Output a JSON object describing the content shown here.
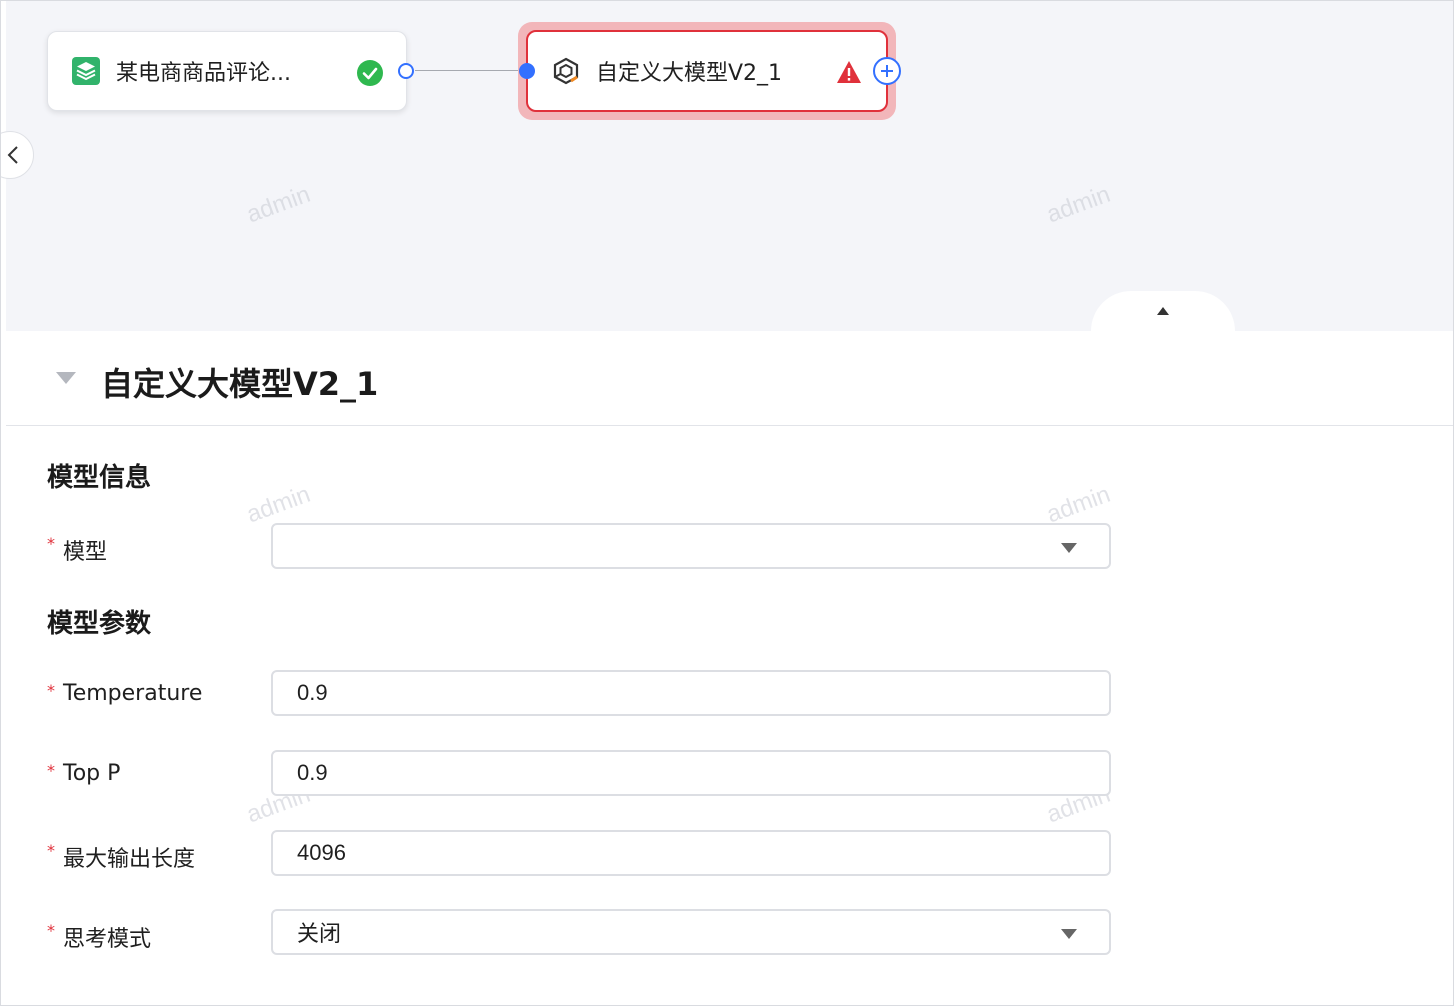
{
  "canvas": {
    "watermark_text": "admin",
    "source_node": {
      "title": "某电商商品评论...",
      "status": "success"
    },
    "model_node": {
      "title": "自定义大模型V2_1",
      "status": "error"
    }
  },
  "panel": {
    "title": "自定义大模型V2_1",
    "sections": {
      "model_info": "模型信息",
      "model_params": "模型参数"
    },
    "fields": {
      "model": {
        "label": "模型",
        "value": ""
      },
      "temperature": {
        "label": "Temperature",
        "value": "0.9"
      },
      "top_p": {
        "label": "Top P",
        "value": "0.9"
      },
      "max_output": {
        "label": "最大输出长度",
        "value": "4096"
      },
      "thinking_mode": {
        "label": "思考模式",
        "value": "关闭"
      }
    },
    "required_marker": "*"
  },
  "colors": {
    "accent_blue": "#3370ff",
    "error_red": "#e0313b",
    "success_green": "#2fb84f",
    "canvas_bg": "#f4f5f9"
  }
}
